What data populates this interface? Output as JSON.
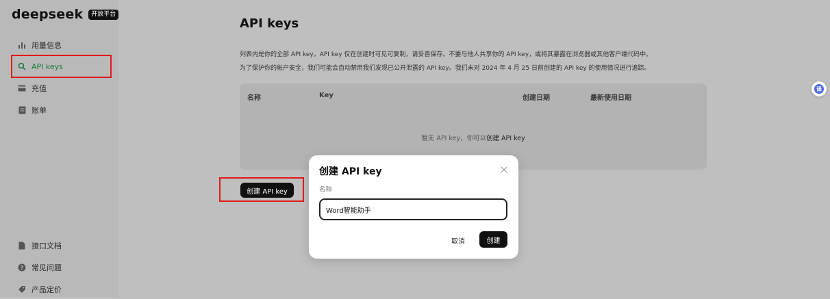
{
  "brand": {
    "name": "deepseek",
    "badge": "开放平台"
  },
  "sidebar": {
    "items": [
      {
        "label": "用量信息",
        "icon": "bar-chart-icon"
      },
      {
        "label": "API keys",
        "icon": "search-icon",
        "active": true
      },
      {
        "label": "充值",
        "icon": "card-icon"
      },
      {
        "label": "账单",
        "icon": "bill-icon"
      }
    ],
    "bottom_items": [
      {
        "label": "接口文档",
        "icon": "document-icon"
      },
      {
        "label": "常见问题",
        "icon": "question-icon"
      },
      {
        "label": "产品定价",
        "icon": "tag-icon"
      }
    ]
  },
  "main": {
    "title": "API keys",
    "desc_line1": "列表内是你的全部 API key，API key 仅在创建时可见可复制，请妥善保存。不要与他人共享你的 API key，或将其暴露在浏览器或其他客户端代码中。",
    "desc_line2": "为了保护你的帐户安全，我们可能会自动禁用我们发现已公开泄露的 API key。我们未对 2024 年 4 月 25 日前创建的 API key 的使用情况进行追踪。",
    "table": {
      "columns": [
        "名称",
        "Key",
        "创建日期",
        "最新使用日期"
      ],
      "empty_prefix": "暂无 API key，你可以",
      "empty_link": "创建 API key"
    },
    "create_button": "创建 API key"
  },
  "modal": {
    "title": "创建 API key",
    "name_label": "名称",
    "name_value": "Word智能助手",
    "cancel": "取消",
    "confirm": "创建"
  },
  "translate": {
    "glyph": "译"
  },
  "colors": {
    "active_nav": "#1d7a3a",
    "highlight_box": "#e0191b",
    "primary_button": "#111111"
  }
}
